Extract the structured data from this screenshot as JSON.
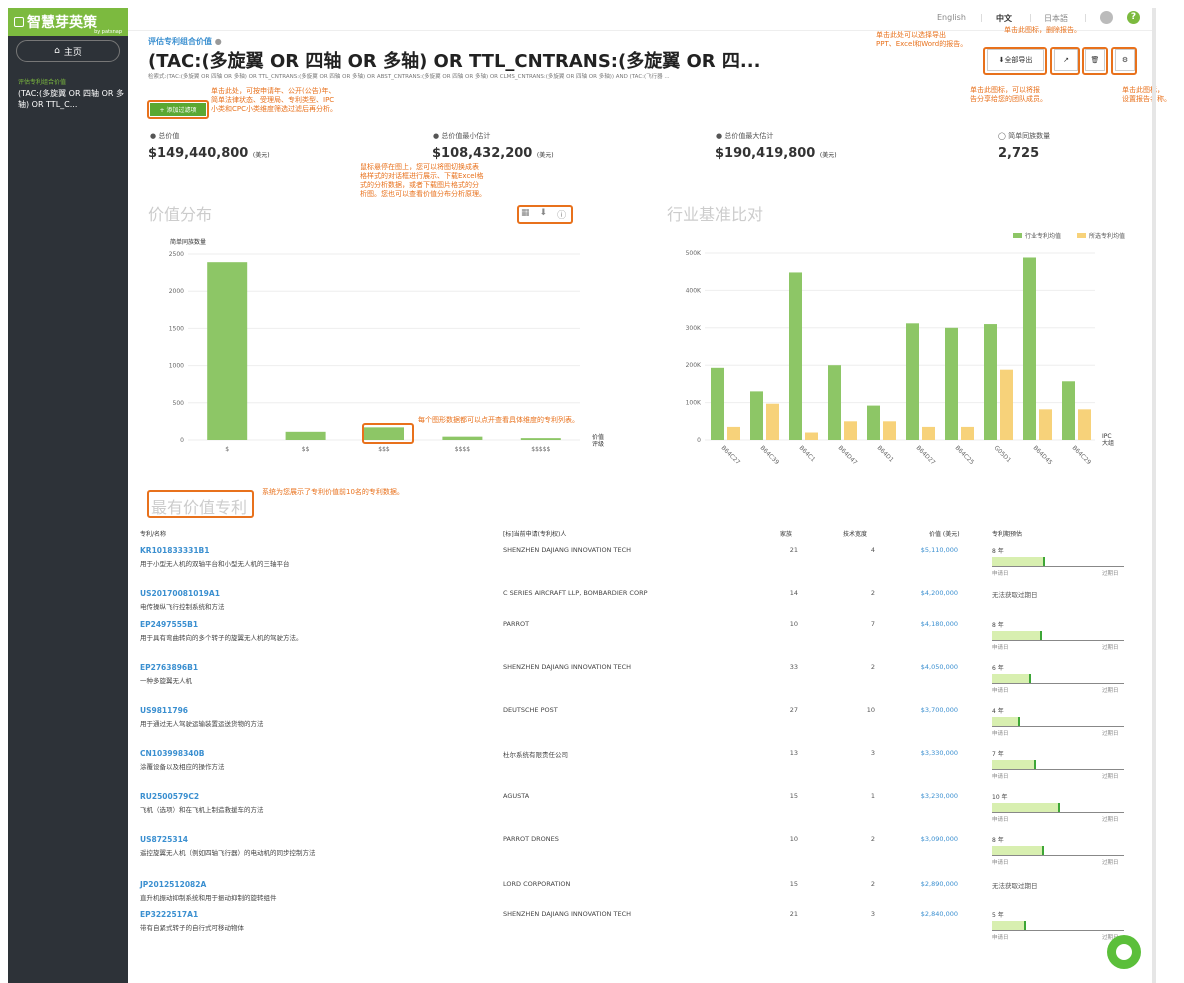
{
  "sidebar": {
    "logo": "智慧芽英策",
    "logo_sub": "by patsnap",
    "home": "主页",
    "nav_small": "评估专利组合价值",
    "nav_query": "(TAC:(多旋翼 OR 四轴 OR 多轴) OR TTL_C..."
  },
  "topbar": {
    "lang_en": "English",
    "lang_zh": "中文",
    "lang_ja": "日本語",
    "sep": "|"
  },
  "header": {
    "label": "评估专利组合价值",
    "title": "(TAC:(多旋翼 OR 四轴 OR 多轴) OR TTL_CNTRANS:(多旋翼 OR 四...",
    "query": "检索式:(TAC:(多旋翼 OR 四轴 OR 多轴) OR TTL_CNTRANS:(多旋翼 OR 四轴 OR 多轴) OR ABST_CNTRANS:(多旋翼 OR 四轴 OR 多轴) OR CLMS_CNTRANS:(多旋翼 OR 四轴 OR 多轴)) AND (TAC:(飞行器 ..."
  },
  "toolbar": {
    "export_all": "全部导出"
  },
  "filter_button": "+ 添加过滤项",
  "annotations": {
    "export": "单击此处可以选择导出\nPPT、Excel和Word的报告。",
    "delete_top": "单击此图标，删除报告。",
    "share": "单击此图标，可以将报\n告分享给您的团队成员。",
    "settings": "单击此图标，\n设置报告名称。",
    "filter": "单击此处，可按申请年、公开(公告)年、\n简单法律状态、受理局、专利类型、IPC\n小类和CPC小类维度筛选过滤后再分析。",
    "chart_hover": "鼠标悬停在图上，您可以将图切换成表\n格样式的对话框进行展示、下载Excel格\n式的分析数据，或者下载图片格式的分\n析图。您也可以查看价值分布分析原理。",
    "bar_click": "每个图形数据都可以点开查看具体维度的专利列表。",
    "top10": "系统为您展示了专利价值前10名的专利数据。"
  },
  "stats": [
    {
      "label": "总价值",
      "value": "$149,440,800",
      "unit": "(美元)"
    },
    {
      "label": "总价值最小估计",
      "value": "$108,432,200",
      "unit": "(美元)"
    },
    {
      "label": "总价值最大估计",
      "value": "$190,419,800",
      "unit": "(美元)"
    },
    {
      "label": "简单同族数量",
      "value": "2,725",
      "unit": ""
    }
  ],
  "sections": {
    "value_dist": "价值分布",
    "benchmark": "行业基准比对",
    "top_patents": "最有价值专利"
  },
  "chart_data": [
    {
      "type": "bar",
      "ylabel": "简单同族数量",
      "xlabel": "价值\n评级",
      "categories": [
        "$",
        "$$",
        "$$$",
        "$$$$",
        "$$$$$"
      ],
      "values": [
        2390,
        110,
        170,
        45,
        25
      ],
      "ylim": [
        0,
        2500
      ],
      "yticks": [
        0,
        500,
        1000,
        1500,
        2000,
        2500
      ],
      "color": "#8dc666"
    },
    {
      "type": "bar",
      "xlabel": "IPC\n大组",
      "categories": [
        "B64C27",
        "B64C39",
        "B64C1",
        "B64D47",
        "B64D1",
        "B64D27",
        "B64C25",
        "G05D1",
        "B64D45",
        "B64C29"
      ],
      "series": [
        {
          "name": "行业专利均值",
          "values": [
            193000,
            130000,
            448000,
            200000,
            92000,
            312000,
            300000,
            310000,
            488000,
            157000
          ],
          "color": "#8dc666"
        },
        {
          "name": "所选专利均值",
          "values": [
            35000,
            97000,
            20000,
            50000,
            50000,
            35000,
            35000,
            188000,
            82000,
            82000
          ],
          "color": "#f7d27a"
        }
      ],
      "ylim": [
        0,
        500000
      ],
      "yticks": [
        "0",
        "100K",
        "200K",
        "300K",
        "400K",
        "500K"
      ],
      "legend": "top-right"
    }
  ],
  "table": {
    "headers": [
      "专利/名称",
      "[标]当前申请(专利权)人",
      "家族",
      "技术宽度",
      "价值 (美元)",
      "专利期预估"
    ],
    "apply_label": "申请日",
    "expire_label": "过期日",
    "rows": [
      {
        "id": "KR101833331B1",
        "name": "用于小型无人机的双轴平台和小型无人机的三轴平台",
        "applicant": "SHENZHEN DAJIANG INNOVATION TECH",
        "family": "21",
        "breadth": "4",
        "value": "$5,110,000",
        "life": "8 年",
        "life_frac": 0.39
      },
      {
        "id": "US20170081019A1",
        "name": "电传操纵飞行控制系统和方法",
        "applicant": "C SERIES AIRCRAFT LLP, BOMBARDIER CORP",
        "family": "14",
        "breadth": "2",
        "value": "$4,200,000",
        "life": "无法获取过期日",
        "life_frac": null
      },
      {
        "id": "EP2497555B1",
        "name": "用于具有弯曲转向的多个转子的旋翼无人机的驾驶方法。",
        "applicant": "PARROT",
        "family": "10",
        "breadth": "7",
        "value": "$4,180,000",
        "life": "8 年",
        "life_frac": 0.36
      },
      {
        "id": "EP2763896B1",
        "name": "一种多旋翼无人机",
        "applicant": "SHENZHEN DAJIANG INNOVATION TECH",
        "family": "33",
        "breadth": "2",
        "value": "$4,050,000",
        "life": "6 年",
        "life_frac": 0.28
      },
      {
        "id": "US9811796",
        "name": "用于通过无人驾驶运输装置运送货物的方法",
        "applicant": "DEUTSCHE POST",
        "family": "27",
        "breadth": "10",
        "value": "$3,700,000",
        "life": "4 年",
        "life_frac": 0.2
      },
      {
        "id": "CN103998340B",
        "name": "涂覆设备以及相应的操作方法",
        "applicant": "杜尔系统有限责任公司",
        "family": "13",
        "breadth": "3",
        "value": "$3,330,000",
        "life": "7 年",
        "life_frac": 0.32
      },
      {
        "id": "RU2500579C2",
        "name": "飞机（选项）和在飞机上制造救援车的方法",
        "applicant": "AGUSTA",
        "family": "15",
        "breadth": "1",
        "value": "$3,230,000",
        "life": "10 年",
        "life_frac": 0.5
      },
      {
        "id": "US8725314",
        "name": "遥控旋翼无人机（例如四轴飞行器）的电动机的同步控制方法",
        "applicant": "PARROT DRONES",
        "family": "10",
        "breadth": "2",
        "value": "$3,090,000",
        "life": "8 年",
        "life_frac": 0.38
      },
      {
        "id": "JP2012512082A",
        "name": "直升机振动抑制系统和用于振动抑制的旋转组件",
        "applicant": "LORD CORPORATION",
        "family": "15",
        "breadth": "2",
        "value": "$2,890,000",
        "life": "无法获取过期日",
        "life_frac": null
      },
      {
        "id": "EP3222517A1",
        "name": "带有自紧式转子的自行式可移动物体",
        "applicant": "SHENZHEN DAJIANG INNOVATION TECH",
        "family": "21",
        "breadth": "3",
        "value": "$2,840,000",
        "life": "5 年",
        "life_frac": 0.24
      }
    ]
  }
}
